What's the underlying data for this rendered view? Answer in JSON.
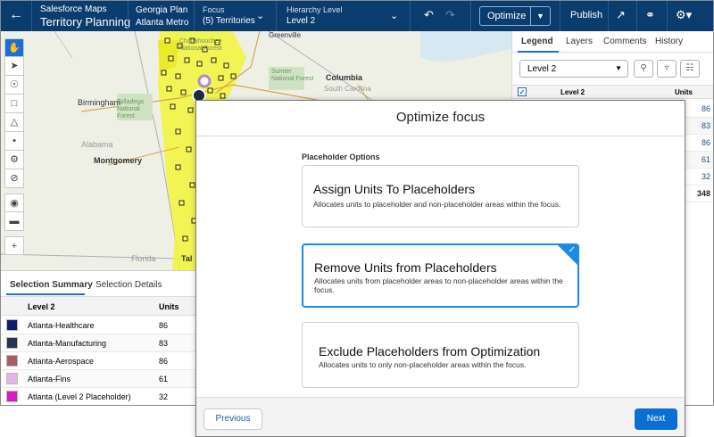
{
  "header": {
    "app_subtitle": "Salesforce Maps",
    "app_title": "Territory Planning",
    "plan_label": "Georgia Plan",
    "plan_value": "Atlanta Metro",
    "focus_label": "Focus",
    "focus_value": "(5) Territories",
    "hierarchy_label": "Hierarchy Level",
    "hierarchy_value": "Level 2",
    "optimize_label": "Optimize",
    "publish_label": "Publish"
  },
  "map": {
    "labels": [
      "Greenville",
      "Columbia",
      "South Carolina",
      "Sumter National Forest",
      "Birmingham",
      "Talladega National Forest",
      "Alabama",
      "Montgomery",
      "Florida",
      "Chattahoochee National Forest",
      "Tal"
    ]
  },
  "right_panel": {
    "tabs": [
      "Legend",
      "Layers",
      "Comments",
      "History"
    ],
    "level_select": "Level 2",
    "header_level": "Level 2",
    "header_units": "Units",
    "values": [
      "86",
      "83",
      "86",
      "61",
      "32",
      "348"
    ]
  },
  "selection": {
    "tabs": [
      "Selection Summary",
      "Selection Details"
    ],
    "header_level": "Level 2",
    "header_units": "Units",
    "rows": [
      {
        "name": "Atlanta-Healthcare",
        "units": "86",
        "color": "#0d1f6b"
      },
      {
        "name": "Atlanta-Manufacturing",
        "units": "83",
        "color": "#263452"
      },
      {
        "name": "Atlanta-Aerospace",
        "units": "86",
        "color": "#a45e63"
      },
      {
        "name": "Atlanta-Fins",
        "units": "61",
        "color": "#e3b6e8"
      },
      {
        "name": "Atlanta (Level 2 Placeholder)",
        "units": "32",
        "color": "#d61cc2"
      }
    ]
  },
  "modal": {
    "title": "Optimize focus",
    "section_label": "Placeholder Options",
    "options": [
      {
        "title": "Assign Units To Placeholders",
        "desc": "Allocates units to placeholder and non-placeholder areas within the focus."
      },
      {
        "title": "Remove Units from Placeholders",
        "desc": "Allocates units from placeholder areas to non-placeholder areas within the focus."
      },
      {
        "title": "Exclude Placeholders from Optimization",
        "desc": "Allocates units to only non-placeholder areas within the focus."
      }
    ],
    "selected_option_index": 1,
    "previous_label": "Previous",
    "next_label": "Next"
  },
  "colors": {
    "header_bg": "#0b3c6e",
    "accent": "#1b8be6",
    "next_button": "#0a6fd0",
    "territory_fill": "#f2f53a"
  }
}
